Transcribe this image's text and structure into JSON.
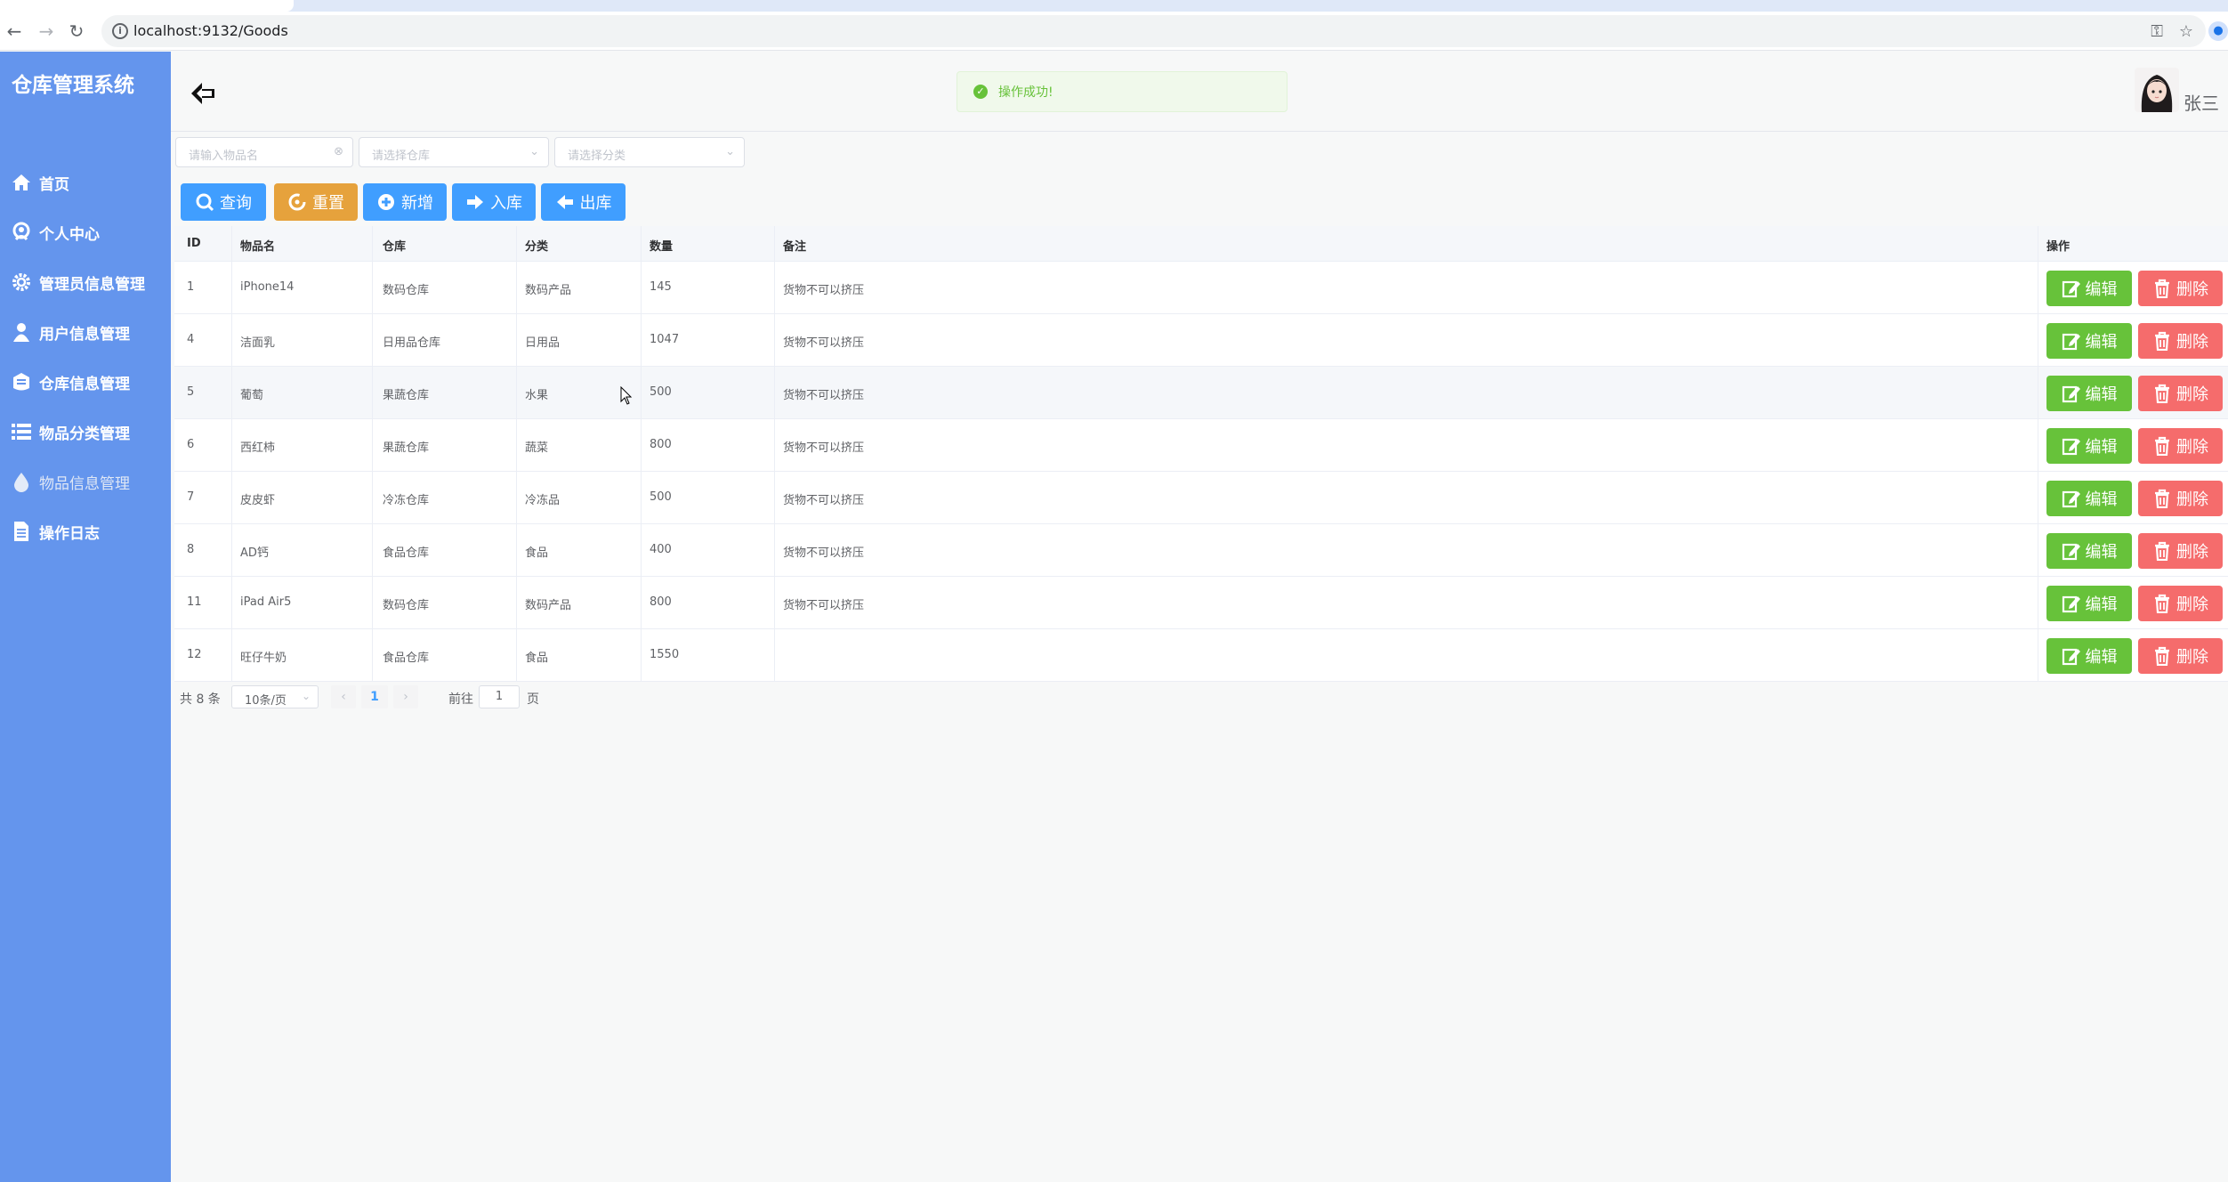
{
  "browser": {
    "url": "localhost:9132/Goods"
  },
  "sidebar": {
    "title": "仓库管理系统",
    "items": [
      {
        "label": "首页",
        "icon": "home-icon"
      },
      {
        "label": "个人中心",
        "icon": "user-center-icon"
      },
      {
        "label": "管理员信息管理",
        "icon": "gear-icon"
      },
      {
        "label": "用户信息管理",
        "icon": "user-icon"
      },
      {
        "label": "仓库信息管理",
        "icon": "warehouse-icon"
      },
      {
        "label": "物品分类管理",
        "icon": "list-icon"
      },
      {
        "label": "物品信息管理",
        "icon": "drop-icon",
        "active": true
      },
      {
        "label": "操作日志",
        "icon": "document-icon"
      }
    ]
  },
  "header": {
    "toast": "操作成功!",
    "username": "张三"
  },
  "filters": {
    "name_placeholder": "请输入物品名",
    "warehouse_placeholder": "请选择仓库",
    "category_placeholder": "请选择分类"
  },
  "actions": {
    "query": "查询",
    "reset": "重置",
    "add": "新增",
    "stock_in": "入库",
    "stock_out": "出库"
  },
  "table": {
    "columns": [
      "ID",
      "物品名",
      "仓库",
      "分类",
      "数量",
      "备注",
      "操作"
    ],
    "rows": [
      {
        "id": "1",
        "name": "iPhone14",
        "warehouse": "数码仓库",
        "category": "数码产品",
        "count": "145",
        "remark": "货物不可以挤压"
      },
      {
        "id": "4",
        "name": "洁面乳",
        "warehouse": "日用品仓库",
        "category": "日用品",
        "count": "1047",
        "remark": "货物不可以挤压"
      },
      {
        "id": "5",
        "name": "葡萄",
        "warehouse": "果蔬仓库",
        "category": "水果",
        "count": "500",
        "remark": "货物不可以挤压"
      },
      {
        "id": "6",
        "name": "西红柿",
        "warehouse": "果蔬仓库",
        "category": "蔬菜",
        "count": "800",
        "remark": "货物不可以挤压"
      },
      {
        "id": "7",
        "name": "皮皮虾",
        "warehouse": "冷冻仓库",
        "category": "冷冻品",
        "count": "500",
        "remark": "货物不可以挤压"
      },
      {
        "id": "8",
        "name": "AD钙",
        "warehouse": "食品仓库",
        "category": "食品",
        "count": "400",
        "remark": "货物不可以挤压"
      },
      {
        "id": "11",
        "name": "iPad Air5",
        "warehouse": "数码仓库",
        "category": "数码产品",
        "count": "800",
        "remark": "货物不可以挤压"
      },
      {
        "id": "12",
        "name": "旺仔牛奶",
        "warehouse": "食品仓库",
        "category": "食品",
        "count": "1550",
        "remark": ""
      }
    ],
    "edit_label": "编辑",
    "delete_label": "删除"
  },
  "pagination": {
    "total": "共 8 条",
    "page_size": "10条/页",
    "current_page": "1",
    "goto_label": "前往",
    "goto_value": "1",
    "page_suffix": "页"
  }
}
